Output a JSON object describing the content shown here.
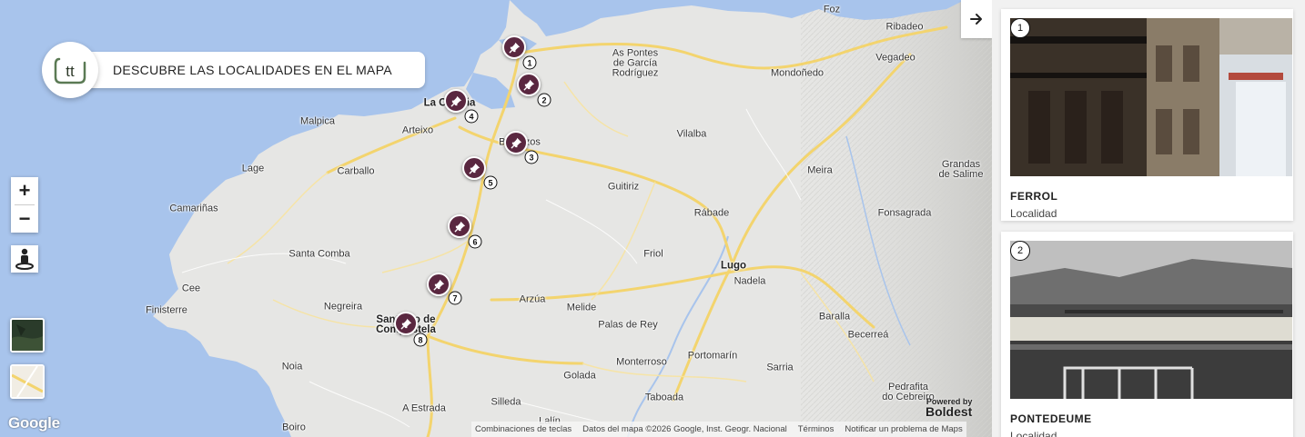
{
  "banner": {
    "text": "DESCUBRE LAS LOCALIDADES EN EL MAPA",
    "logo_text": "tt"
  },
  "places": [
    {
      "id": "foz",
      "label": "Foz"
    },
    {
      "id": "ribadeo",
      "label": "Ribadeo"
    },
    {
      "id": "vegadeo",
      "label": "Vegadeo"
    },
    {
      "id": "as-pontes",
      "label": "As Pontes\nde García\nRodríguez"
    },
    {
      "id": "mondonedo",
      "label": "Mondoñedo"
    },
    {
      "id": "la-coruna",
      "label": "La Coruña"
    },
    {
      "id": "malpica",
      "label": "Malpica"
    },
    {
      "id": "arteixo",
      "label": "Arteixo"
    },
    {
      "id": "betanzos",
      "label": "Betanzos"
    },
    {
      "id": "vilalba",
      "label": "Vilalba"
    },
    {
      "id": "lage",
      "label": "Lage"
    },
    {
      "id": "carballo",
      "label": "Carballo"
    },
    {
      "id": "meira",
      "label": "Meira"
    },
    {
      "id": "grandas",
      "label": "Grandas\nde Salime"
    },
    {
      "id": "guitiriz",
      "label": "Guitiriz"
    },
    {
      "id": "camarinas",
      "label": "Camariñas"
    },
    {
      "id": "rabade",
      "label": "Rábade"
    },
    {
      "id": "fonsagrada",
      "label": "Fonsagrada"
    },
    {
      "id": "santa-comba",
      "label": "Santa Comba"
    },
    {
      "id": "friol",
      "label": "Friol"
    },
    {
      "id": "lugo",
      "label": "Lugo"
    },
    {
      "id": "cee",
      "label": "Cee"
    },
    {
      "id": "nadela",
      "label": "Nadela"
    },
    {
      "id": "negreira",
      "label": "Negreira"
    },
    {
      "id": "arzua",
      "label": "Arzúa"
    },
    {
      "id": "finisterre",
      "label": "Finisterre"
    },
    {
      "id": "melide",
      "label": "Melide"
    },
    {
      "id": "santiago",
      "label": "Santiago de\nCompostela"
    },
    {
      "id": "palas",
      "label": "Palas de Rey"
    },
    {
      "id": "baralla",
      "label": "Baralla"
    },
    {
      "id": "becerrea",
      "label": "Becerreá"
    },
    {
      "id": "portomarin",
      "label": "Portomarín"
    },
    {
      "id": "noia",
      "label": "Noia"
    },
    {
      "id": "monterroso",
      "label": "Monterroso"
    },
    {
      "id": "sarria",
      "label": "Sarria"
    },
    {
      "id": "golada",
      "label": "Golada"
    },
    {
      "id": "pedrafita",
      "label": "Pedrafita\ndo Cebreiro"
    },
    {
      "id": "taboada",
      "label": "Taboada"
    },
    {
      "id": "a-estrada",
      "label": "A Estrada"
    },
    {
      "id": "silleda",
      "label": "Silleda"
    },
    {
      "id": "boiro",
      "label": "Boiro"
    },
    {
      "id": "lalin",
      "label": "Lalín"
    }
  ],
  "markers": [
    "1",
    "2",
    "3",
    "4",
    "5",
    "6",
    "7",
    "8"
  ],
  "controls": {
    "zoom_in": "+",
    "zoom_out": "−"
  },
  "footer": {
    "google": "Google",
    "shortcuts": "Combinaciones de teclas",
    "map_data": "Datos del mapa ©2026 Google, Inst. Geogr. Nacional",
    "terms": "Términos",
    "report": "Notificar un problema de Maps",
    "powered_by": "Powered by",
    "brand": "Boldest"
  },
  "cards": [
    {
      "num": "1",
      "title": "FERROL",
      "subtitle": "Localidad"
    },
    {
      "num": "2",
      "title": "PONTEDEUME",
      "subtitle": "Localidad"
    }
  ],
  "colors": {
    "pin": "#5a2740",
    "sea": "#a8c4ec",
    "road": "#f3d46e",
    "land": "#e8e8e6"
  }
}
